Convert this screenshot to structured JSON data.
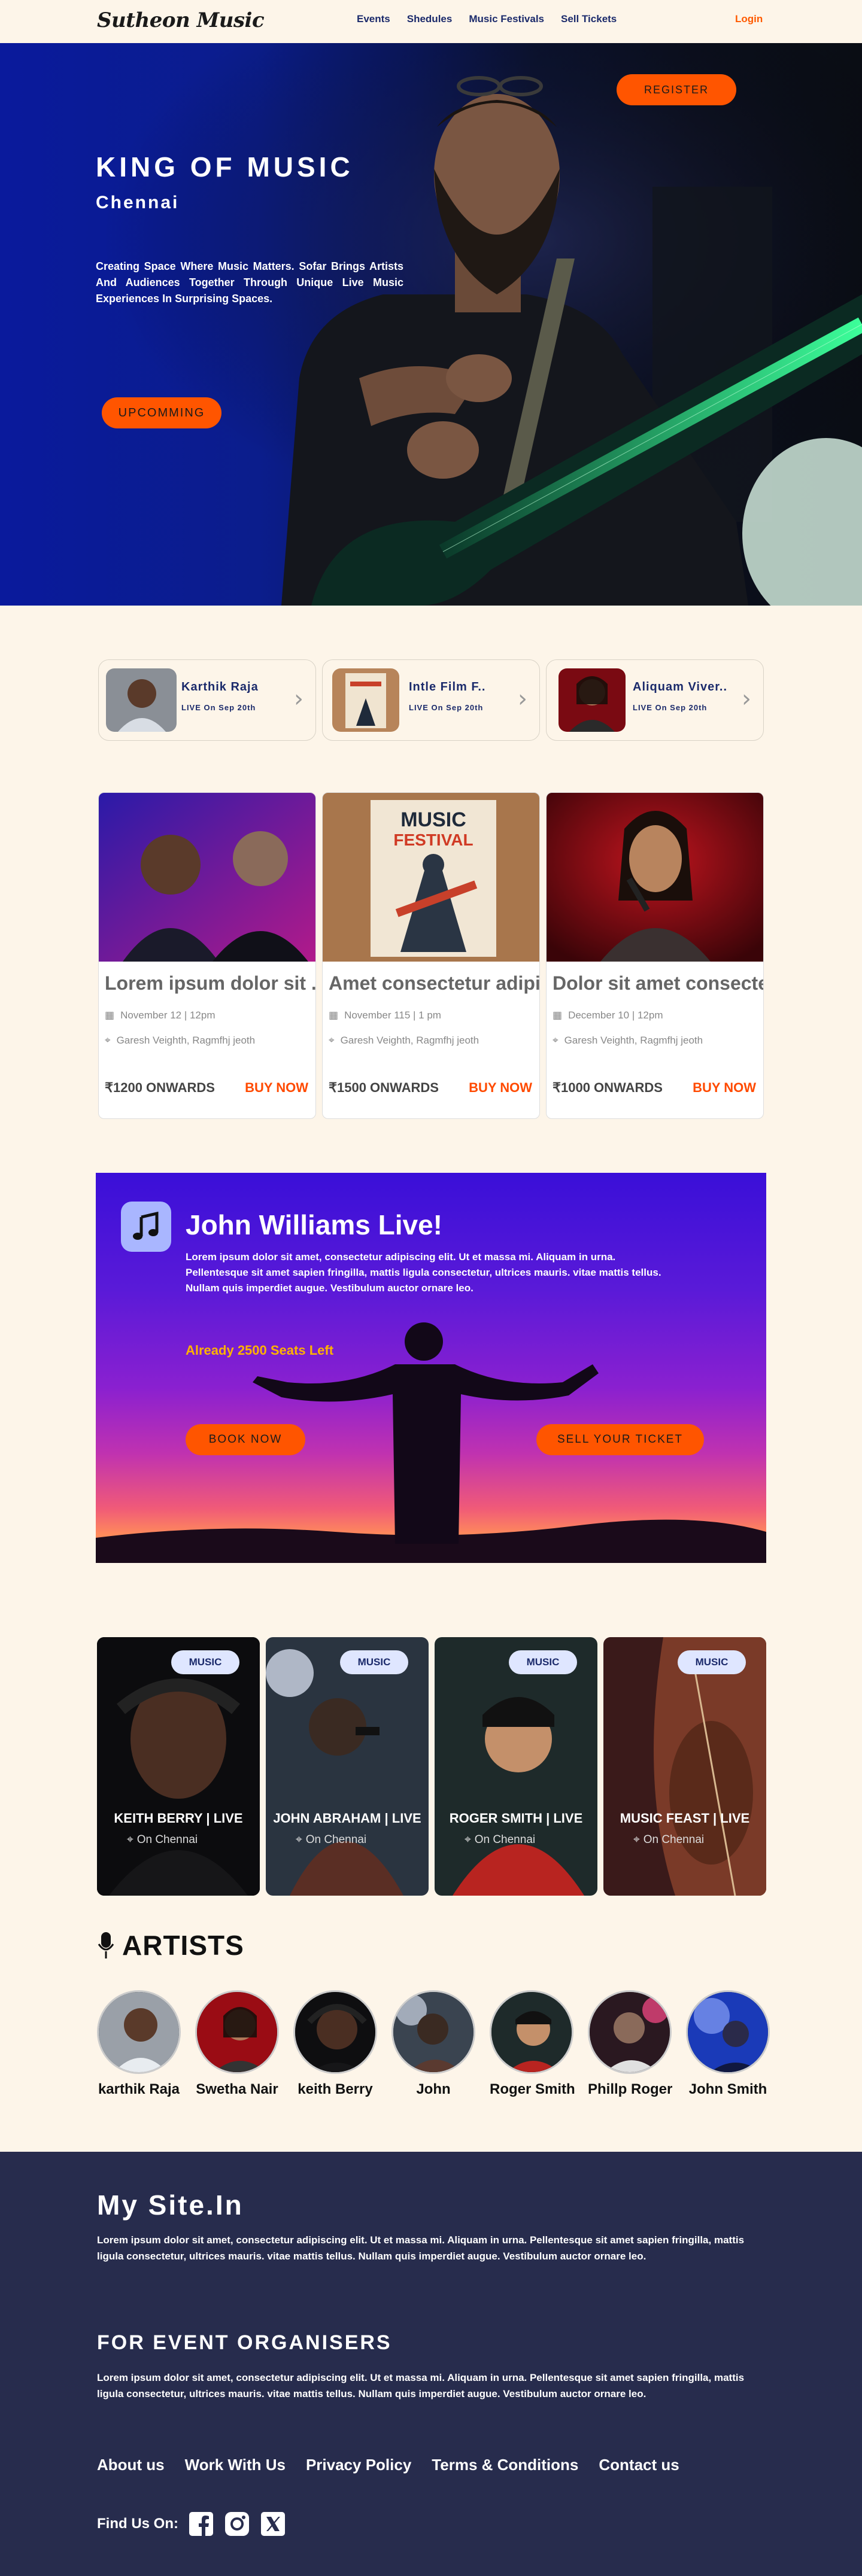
{
  "brand": {
    "logo": "Sutheon Music"
  },
  "nav": {
    "links": [
      "Events",
      "Shedules",
      "Music Festivals",
      "Sell Tickets"
    ],
    "login": "Login"
  },
  "hero": {
    "register": "REGISTER",
    "title": "KING OF MUSIC",
    "city": "Chennai",
    "description": "Creating Space Where Music Matters. Sofar Brings Artists And Audiences Together Through Unique Live Music Experiences In Surprising Spaces.",
    "upcoming": "UPCOMMING"
  },
  "featured": [
    {
      "name": "Karthik Raja",
      "date": "LIVE On Sep 20th"
    },
    {
      "name": "Intle Film F..",
      "date": "LIVE On Sep 20th"
    },
    {
      "name": "Aliquam Viver..",
      "date": "LIVE On Sep 20th"
    }
  ],
  "events": [
    {
      "title": "Lorem ipsum dolor sit ....",
      "date": "November 12 | 12pm",
      "venue": "Garesh Veighth, Ragmfhj jeoth",
      "price": "₹1200 ONWARDS",
      "buy": "BUY NOW"
    },
    {
      "title": "Amet consectetur adipis..",
      "date": "November 115 | 1 pm",
      "venue": "Garesh Veighth, Ragmfhj jeoth",
      "price": "₹1500 ONWARDS",
      "buy": "BUY NOW"
    },
    {
      "title": "Dolor sit amet consecte..",
      "date": "December 10 | 12pm",
      "venue": "Garesh Veighth, Ragmfhj jeoth",
      "price": "₹1000 ONWARDS",
      "buy": "BUY NOW"
    }
  ],
  "poster": {
    "line1": "MUSIC",
    "line2": "FESTIVAL"
  },
  "promo": {
    "title": "John Williams Live!",
    "text": "Lorem ipsum dolor sit amet, consectetur adipiscing elit. Ut et massa mi. Aliquam in urna. Pellentesque sit amet sapien fringilla, mattis ligula consectetur, ultrices mauris. vitae mattis tellus. Nullam quis imperdiet augue. Vestibulum auctor ornare leo.",
    "seats": "Already 2500 Seats Left",
    "book": "BOOK NOW",
    "sell": "SELL YOUR TICKET"
  },
  "tiles": [
    {
      "badge": "MUSIC",
      "name": "KEITH BERRY | LIVE",
      "location": "On Chennai"
    },
    {
      "badge": "MUSIC",
      "name": "JOHN ABRAHAM | LIVE",
      "location": "On Chennai"
    },
    {
      "badge": "MUSIC",
      "name": "ROGER SMITH | LIVE",
      "location": "On Chennai"
    },
    {
      "badge": "MUSIC",
      "name": "MUSIC FEAST | LIVE",
      "location": "On Chennai"
    }
  ],
  "artists": {
    "title": "ARTISTS",
    "items": [
      "karthik Raja",
      "Swetha Nair",
      "keith Berry",
      "John",
      "Roger Smith",
      "Phillp Roger",
      "John Smith"
    ]
  },
  "footer": {
    "title": "My Site.In",
    "text1": "Lorem ipsum dolor sit amet, consectetur adipiscing elit. Ut et massa mi. Aliquam in urna. Pellentesque sit amet sapien fringilla, mattis ligula consectetur, ultrices mauris. vitae mattis tellus. Nullam quis imperdiet augue. Vestibulum auctor ornare leo.",
    "subtitle": "FOR EVENT ORGANISERS",
    "text2": "Lorem ipsum dolor sit amet, consectetur adipiscing elit. Ut et massa mi. Aliquam in urna. Pellentesque sit amet sapien fringilla, mattis ligula consectetur, ultrices mauris. vitae mattis tellus. Nullam quis imperdiet augue. Vestibulum auctor ornare leo.",
    "links": [
      "About us",
      "Work With Us",
      "Privacy Policy",
      "Terms & Conditions",
      "Contact us"
    ],
    "find": "Find Us On:",
    "social": [
      "facebook-icon",
      "instagram-icon",
      "x-icon"
    ]
  },
  "colors": {
    "accent": "#ff5500",
    "navy": "#1b2a6b",
    "background": "#fdf5e9",
    "footer": "#272c4d"
  }
}
